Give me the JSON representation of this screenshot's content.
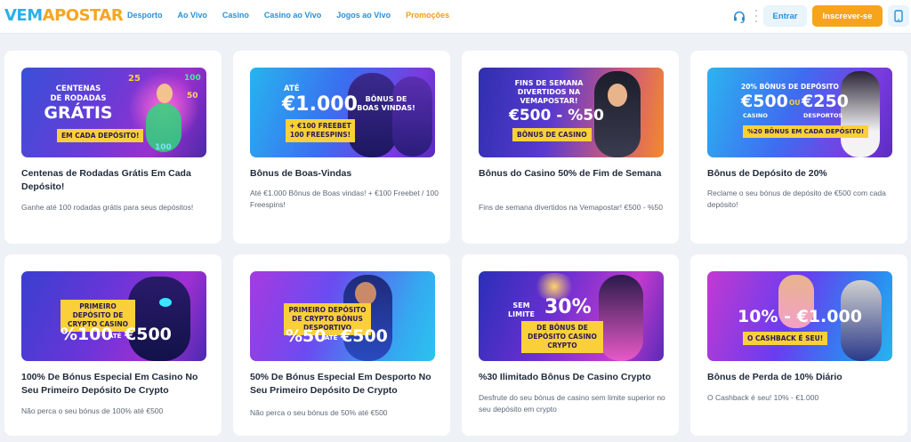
{
  "header": {
    "logo_part1": "VEM",
    "logo_part2": "APOSTAR",
    "nav": [
      "Desporto",
      "Ao Vivo",
      "Casino",
      "Casino ao Vivo",
      "Jogos ao Vivo",
      "Promoções"
    ],
    "login_label": "Entrar",
    "signup_label": "Inscrever-se"
  },
  "colors": {
    "brand_blue": "#2bb0e6",
    "brand_orange": "#f5a623",
    "nav_blue": "#2a8fd6",
    "signup_bg": "#f7a41d"
  },
  "cards": [
    {
      "title": "Centenas de Rodadas Grátis Em Cada Depósito!",
      "description": "Ganhe até 100 rodadas grátis para seus depósitos!",
      "banner": {
        "line1": "Centenas",
        "line2": "de rodadas",
        "big": "Grátis",
        "tag": "Em cada depósito!",
        "reels": [
          "25",
          "100",
          "50",
          "100"
        ]
      }
    },
    {
      "title": "Bônus de Boas-Vindas",
      "description": "Até €1.000 Bônus de Boas vindas! + €100 Freebet / 100 Freespins!",
      "banner": {
        "small": "Até",
        "big": "€1.000",
        "side": "Bônus de boas vindas!",
        "tag": "+ €100 Freebet 100 Freespins!"
      }
    },
    {
      "title": "Bônus do Casino 50% de Fim de Semana",
      "description": "Fins de semana divertidos na Vemapostar! €500 - %50",
      "banner": {
        "line1": "Fins de semana",
        "line2": "divertidos na",
        "line3": "Vemapostar!",
        "big": "€500 - %50",
        "tag": "Bônus de casino"
      }
    },
    {
      "title": "Bônus de Depósito de 20%",
      "description": "Reclame o seu bónus de depósito de €500 com cada depósito!",
      "banner": {
        "top": "20% bônus de depósito",
        "big1": "€500",
        "sub1": "Casino",
        "ou": "ou",
        "big2": "€250",
        "sub2": "Desportos",
        "tag": "%20 bônus em cada depósito!"
      }
    },
    {
      "title": "100% De Bónus Especial Em Casino No Seu Primeiro Depósito De Crypto",
      "description": "Não perca o seu bónus de 100% até €500",
      "banner": {
        "tag": "Primeiro depósito de crypto casino",
        "big1": "%100",
        "ate": "até",
        "big2": "€500"
      }
    },
    {
      "title": "50% De Bónus Especial Em Desporto No Seu Primeiro Depósito De Crypto",
      "description": "Não perca o seu bónus de 50% até €500",
      "banner": {
        "tag": "Primeiro depósito de crypto bônus desportivo",
        "big1": "%50",
        "ate": "até",
        "big2": "€500"
      }
    },
    {
      "title": "%30 Ilimitado Bônus De Casino Crypto",
      "description": "Desfrute do seu bónus de casino sem limite superior no seu depósito em crypto",
      "banner": {
        "side": "Sem limite",
        "big": "30%",
        "tag": "De bônus de depósito casino crypto"
      }
    },
    {
      "title": "Bônus de Perda de 10% Diário",
      "description": "O Cashback é seu! 10% - €1.000",
      "banner": {
        "big": "10% - €1.000",
        "tag": "O cashback é seu!"
      }
    }
  ]
}
